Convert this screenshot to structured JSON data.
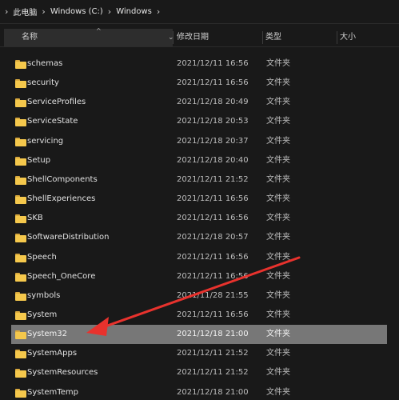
{
  "address": {
    "crumbs": [
      "此电脑",
      "Windows (C:)",
      "Windows"
    ]
  },
  "columns": {
    "name": "名称",
    "date": "修改日期",
    "type": "类型",
    "size": "大小"
  },
  "rows": [
    {
      "name": "schemas",
      "date": "2021/12/11 16:56",
      "type": "文件夹"
    },
    {
      "name": "security",
      "date": "2021/12/11 16:56",
      "type": "文件夹"
    },
    {
      "name": "ServiceProfiles",
      "date": "2021/12/18 20:49",
      "type": "文件夹"
    },
    {
      "name": "ServiceState",
      "date": "2021/12/18 20:53",
      "type": "文件夹"
    },
    {
      "name": "servicing",
      "date": "2021/12/18 20:37",
      "type": "文件夹"
    },
    {
      "name": "Setup",
      "date": "2021/12/18 20:40",
      "type": "文件夹"
    },
    {
      "name": "ShellComponents",
      "date": "2021/12/11 21:52",
      "type": "文件夹"
    },
    {
      "name": "ShellExperiences",
      "date": "2021/12/11 16:56",
      "type": "文件夹"
    },
    {
      "name": "SKB",
      "date": "2021/12/11 16:56",
      "type": "文件夹"
    },
    {
      "name": "SoftwareDistribution",
      "date": "2021/12/18 20:57",
      "type": "文件夹"
    },
    {
      "name": "Speech",
      "date": "2021/12/11 16:56",
      "type": "文件夹"
    },
    {
      "name": "Speech_OneCore",
      "date": "2021/12/11 16:56",
      "type": "文件夹"
    },
    {
      "name": "symbols",
      "date": "2021/11/28 21:55",
      "type": "文件夹"
    },
    {
      "name": "System",
      "date": "2021/12/11 16:56",
      "type": "文件夹"
    },
    {
      "name": "System32",
      "date": "2021/12/18 21:00",
      "type": "文件夹",
      "selected": true
    },
    {
      "name": "SystemApps",
      "date": "2021/12/11 21:52",
      "type": "文件夹"
    },
    {
      "name": "SystemResources",
      "date": "2021/12/11 21:52",
      "type": "文件夹"
    },
    {
      "name": "SystemTemp",
      "date": "2021/12/18 21:00",
      "type": "文件夹"
    }
  ],
  "colors": {
    "annotation_arrow": "#e8322d",
    "folder": "#f5c84c",
    "selection": "#777777"
  }
}
